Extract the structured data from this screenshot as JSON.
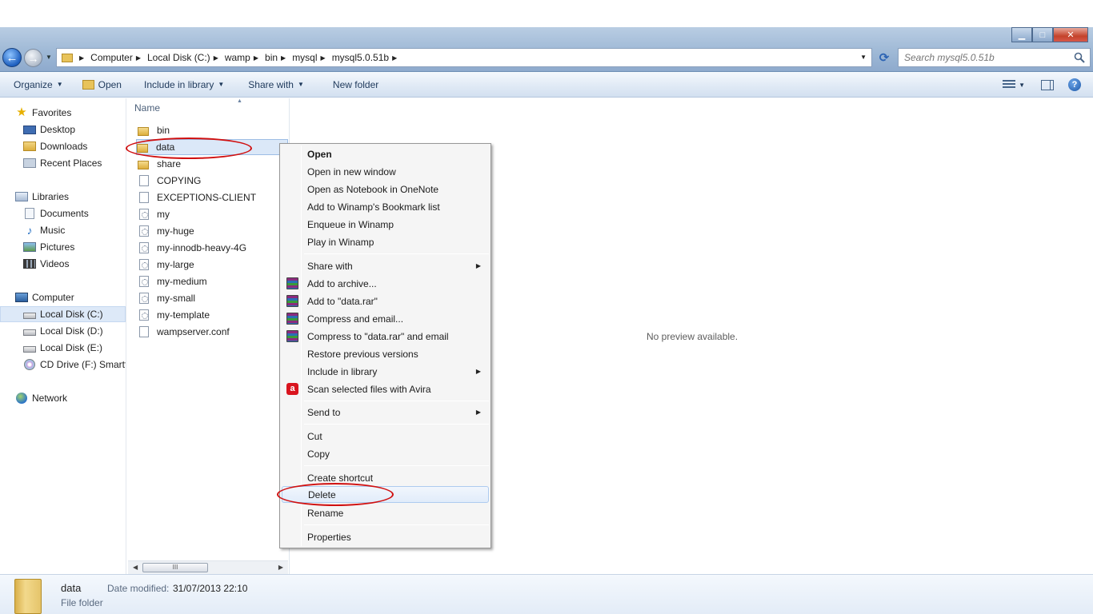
{
  "window": {
    "minimize_glyph": "▁",
    "maximize_glyph": "□",
    "close_glyph": "✕"
  },
  "address_bar": {
    "crumbs": [
      "Computer",
      "Local Disk (C:)",
      "wamp",
      "bin",
      "mysql",
      "mysql5.0.51b"
    ]
  },
  "search": {
    "placeholder": "Search mysql5.0.51b"
  },
  "command_bar": {
    "organize": "Organize",
    "open": "Open",
    "include_in_library": "Include in library",
    "share_with": "Share with",
    "new_folder": "New folder"
  },
  "nav_pane": {
    "favorites": "Favorites",
    "desktop": "Desktop",
    "downloads": "Downloads",
    "recent_places": "Recent Places",
    "libraries": "Libraries",
    "documents": "Documents",
    "music": "Music",
    "pictures": "Pictures",
    "videos": "Videos",
    "computer": "Computer",
    "local_disk_c": "Local Disk (C:)",
    "local_disk_d": "Local Disk (D:)",
    "local_disk_e": "Local Disk (E:)",
    "cd_drive": "CD Drive (F:) Smartfi",
    "network": "Network"
  },
  "file_list": {
    "column_name": "Name",
    "files": [
      {
        "name": "bin",
        "icon": "folder-icon"
      },
      {
        "name": "data",
        "icon": "folder-icon"
      },
      {
        "name": "share",
        "icon": "folder-icon"
      },
      {
        "name": "COPYING",
        "icon": "file-icon"
      },
      {
        "name": "EXCEPTIONS-CLIENT",
        "icon": "file-icon"
      },
      {
        "name": "my",
        "icon": "config-file-icon"
      },
      {
        "name": "my-huge",
        "icon": "config-file-icon"
      },
      {
        "name": "my-innodb-heavy-4G",
        "icon": "config-file-icon"
      },
      {
        "name": "my-large",
        "icon": "config-file-icon"
      },
      {
        "name": "my-medium",
        "icon": "config-file-icon"
      },
      {
        "name": "my-small",
        "icon": "config-file-icon"
      },
      {
        "name": "my-template",
        "icon": "config-file-icon"
      },
      {
        "name": "wampserver.conf",
        "icon": "file-icon"
      }
    ],
    "scroll_thumb": "III"
  },
  "preview": {
    "text": "No preview available."
  },
  "context_menu": {
    "open": "Open",
    "open_new_window": "Open in new window",
    "open_onenote": "Open as Notebook in OneNote",
    "add_winamp_bookmark": "Add to Winamp's Bookmark list",
    "enqueue_winamp": "Enqueue in Winamp",
    "play_winamp": "Play in Winamp",
    "share_with": "Share with",
    "add_to_archive": "Add to archive...",
    "add_to_rar": "Add to \"data.rar\"",
    "compress_email": "Compress and email...",
    "compress_rar_email": "Compress to \"data.rar\" and email",
    "restore_versions": "Restore previous versions",
    "include_in_library": "Include in library",
    "scan_avira": "Scan selected files with Avira",
    "send_to": "Send to",
    "cut": "Cut",
    "copy": "Copy",
    "create_shortcut": "Create shortcut",
    "delete": "Delete",
    "rename": "Rename",
    "properties": "Properties"
  },
  "details_pane": {
    "name": "data",
    "type": "File folder",
    "modified_label": "Date modified:",
    "modified_value": "31/07/2013 22:10"
  },
  "colors": {
    "annotation": "#d01010",
    "selection": "#dbe8f8",
    "command_bar_text": "#1e395b"
  }
}
